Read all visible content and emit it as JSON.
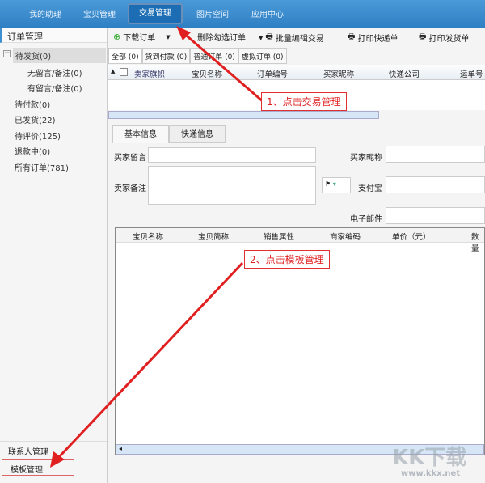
{
  "nav": {
    "items": [
      "我的助理",
      "宝贝管理",
      "交易管理",
      "图片空间",
      "应用中心"
    ],
    "active": "交易管理"
  },
  "sidebar": {
    "title": "订单管理",
    "tree": [
      "待发货(0)",
      "无留言/备注(0)",
      "有留言/备注(0)",
      "待付款(0)",
      "已发货(22)",
      "待评价(125)",
      "退款中(0)",
      "所有订单(781)"
    ],
    "bottom": [
      "联系人管理",
      "模板管理"
    ]
  },
  "toolbar": [
    "下载订单",
    "删除勾选订单",
    "批量编辑交易",
    "打印快递单",
    "打印发货单"
  ],
  "order_tabs": [
    "全部 (0)",
    "货到付款 (0)",
    "普通订单 (0)",
    "虚拟订单 (0)"
  ],
  "grid_headers": [
    "卖家旗帜",
    "宝贝名称",
    "订单编号",
    "买家昵称",
    "快递公司",
    "运单号"
  ],
  "detail_tabs": [
    "基本信息",
    "快递信息"
  ],
  "form": {
    "buyer_msg": "买家留言",
    "seller_note": "卖家备注",
    "buyer_nick": "买家昵称",
    "alipay": "支付宝",
    "email": "电子邮件"
  },
  "item_headers": [
    "宝贝名称",
    "宝贝简称",
    "销售属性",
    "商家编码",
    "单价（元）",
    "数量"
  ],
  "annotations": [
    "1、点击交易管理",
    "2、点击模板管理"
  ],
  "watermark": {
    "logo": "KK下载",
    "url": "www.kkx.net"
  },
  "colors": {
    "nav": "#3d8fd0",
    "annotation": "#e02020"
  }
}
